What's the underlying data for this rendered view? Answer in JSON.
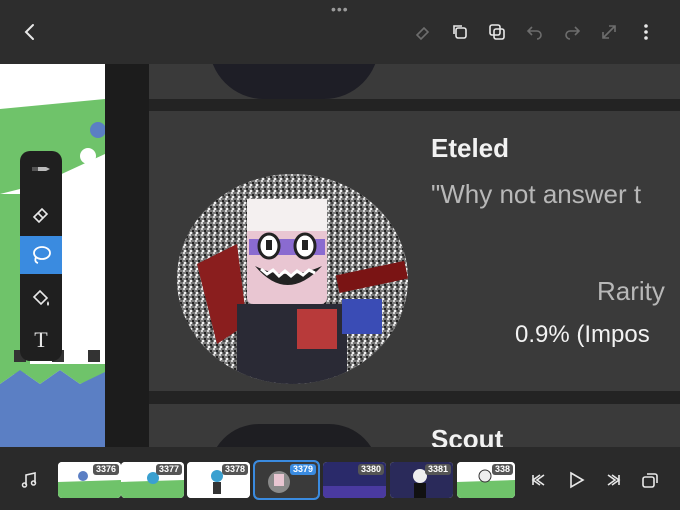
{
  "topbar": {
    "icons": [
      "chevron-left-icon",
      "eraser-icon",
      "copy-layers-icon",
      "duplicate-icon",
      "undo-icon",
      "redo-icon",
      "resize-icon",
      "more-icon"
    ],
    "grabber": "•••"
  },
  "cards": {
    "eteled": {
      "name": "Eteled",
      "quote": "\"Why not answer t",
      "rarity_label": "Rarity",
      "rarity_value": "0.9% (Impos"
    },
    "scout": {
      "name": "Scout"
    }
  },
  "tools": [
    {
      "name": "pen",
      "icon": "pen-icon"
    },
    {
      "name": "eraser",
      "icon": "eraser-icon"
    },
    {
      "name": "lasso",
      "icon": "lasso-icon",
      "active": true
    },
    {
      "name": "fill",
      "icon": "paint-bucket-icon"
    },
    {
      "name": "text",
      "icon": "text-icon",
      "label": "T"
    }
  ],
  "timeline": {
    "frames": [
      "3376",
      "3377",
      "3378",
      "3379",
      "3380",
      "3381",
      "338"
    ],
    "active_frame": "3379",
    "icons": [
      "music-icon",
      "skip-back-icon",
      "play-icon",
      "skip-forward-icon",
      "add-frame-icon"
    ]
  },
  "colors": {
    "accent": "#3a8be0",
    "card_bg": "#3a3a3a",
    "green": "#6fc36a",
    "blue": "#5b7fc4"
  }
}
